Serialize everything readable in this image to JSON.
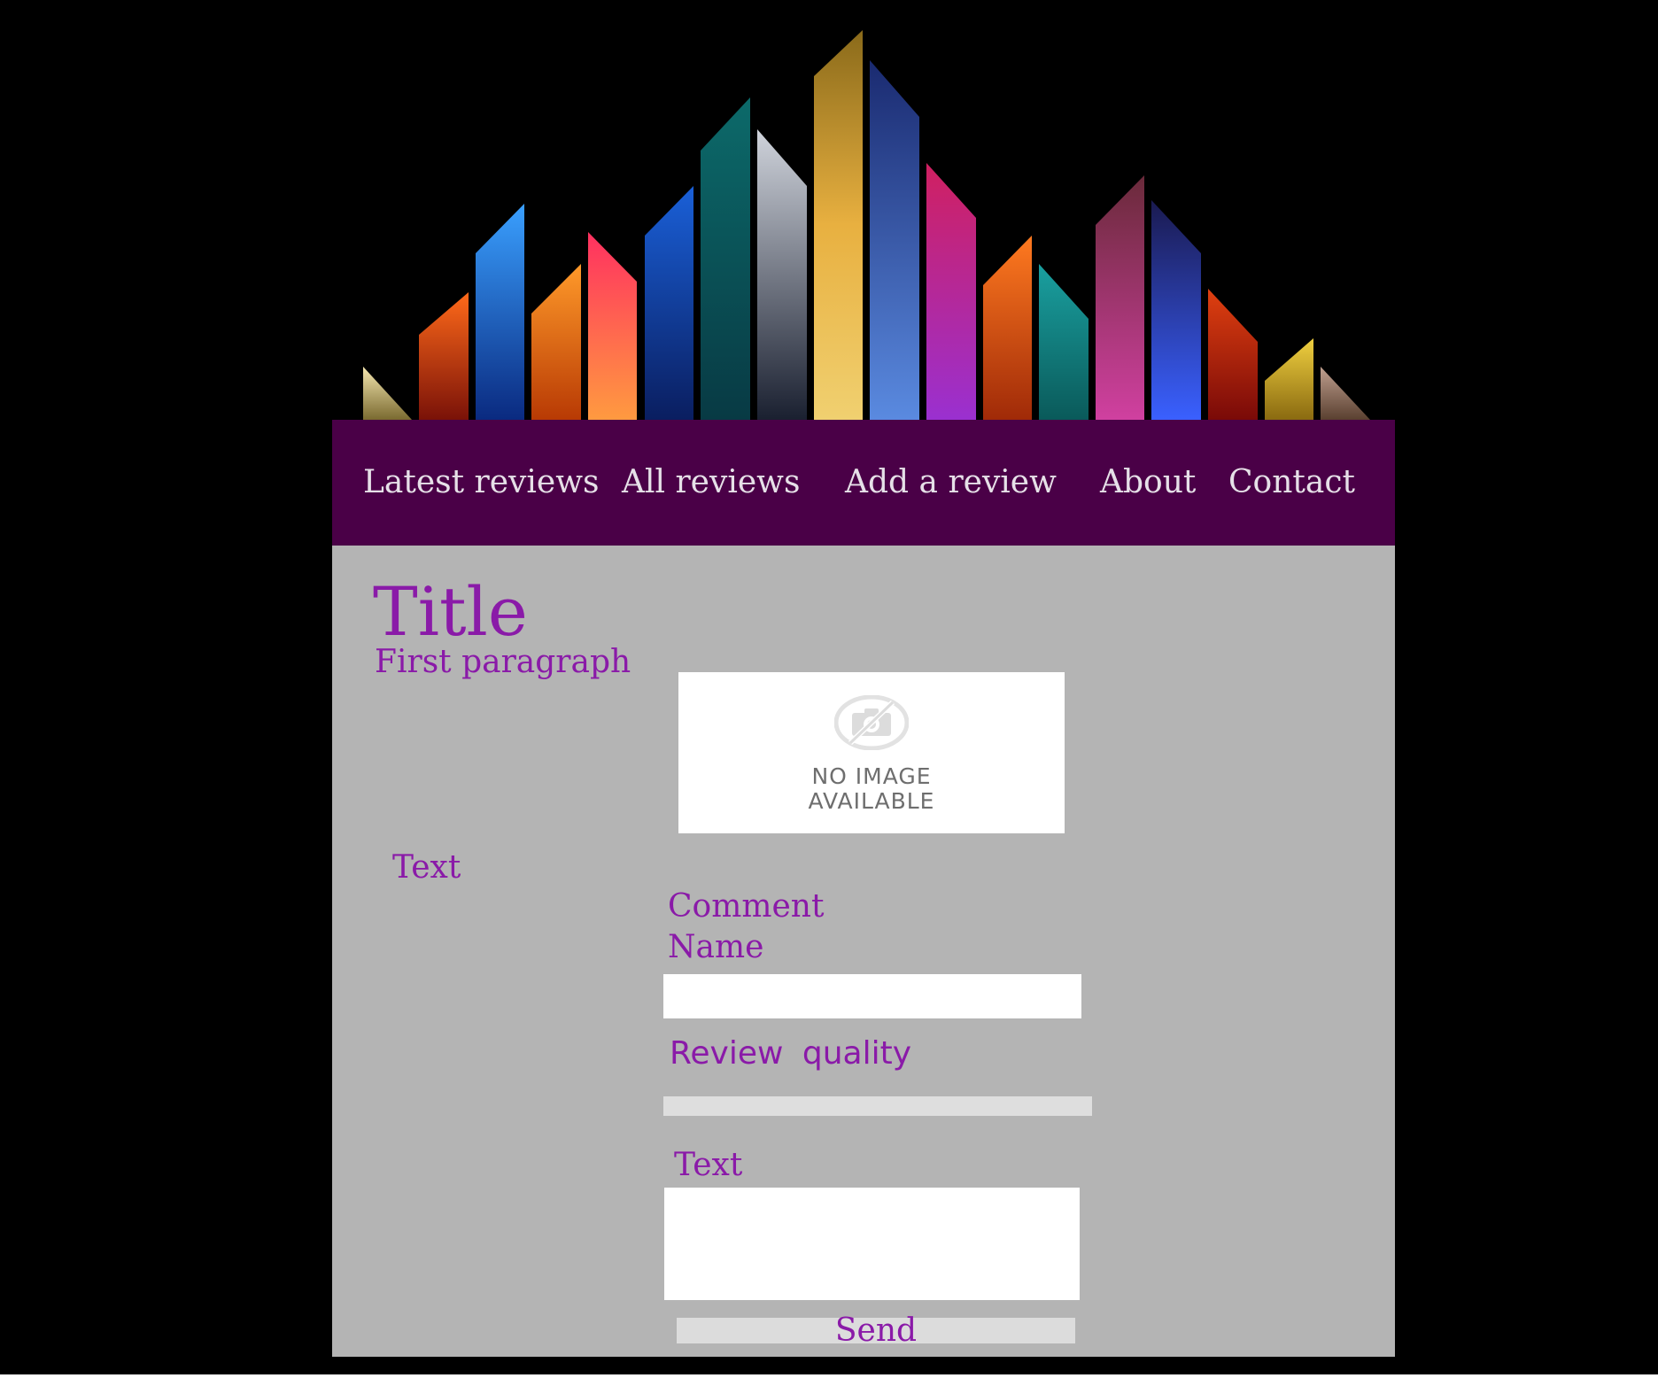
{
  "colors": {
    "page_background": "#000000",
    "nav_background": "#4a0047",
    "nav_text": "#e6e0e8",
    "content_background": "#b4b4b4",
    "accent_purple": "#8a1aa8",
    "input_background": "#ffffff",
    "slider_track": "#dedede",
    "button_background": "#dcdcdc"
  },
  "header": {
    "banner_icon": "crystal-shards-banner"
  },
  "nav": {
    "items": [
      {
        "label": "Latest reviews"
      },
      {
        "label": "All reviews"
      },
      {
        "label": "Add a review"
      },
      {
        "label": "About"
      },
      {
        "label": "Contact"
      }
    ]
  },
  "main": {
    "title": "Title",
    "first_paragraph": "First paragraph",
    "image": {
      "icon": "camera-off-icon",
      "line1": "NO IMAGE",
      "line2": "AVAILABLE"
    },
    "side_text": "Text"
  },
  "comment_form": {
    "heading": "Comment",
    "name_label": "Name",
    "name_value": "",
    "quality_label": "Review quality",
    "text_label": "Text",
    "text_value": "",
    "send_label": "Send"
  }
}
